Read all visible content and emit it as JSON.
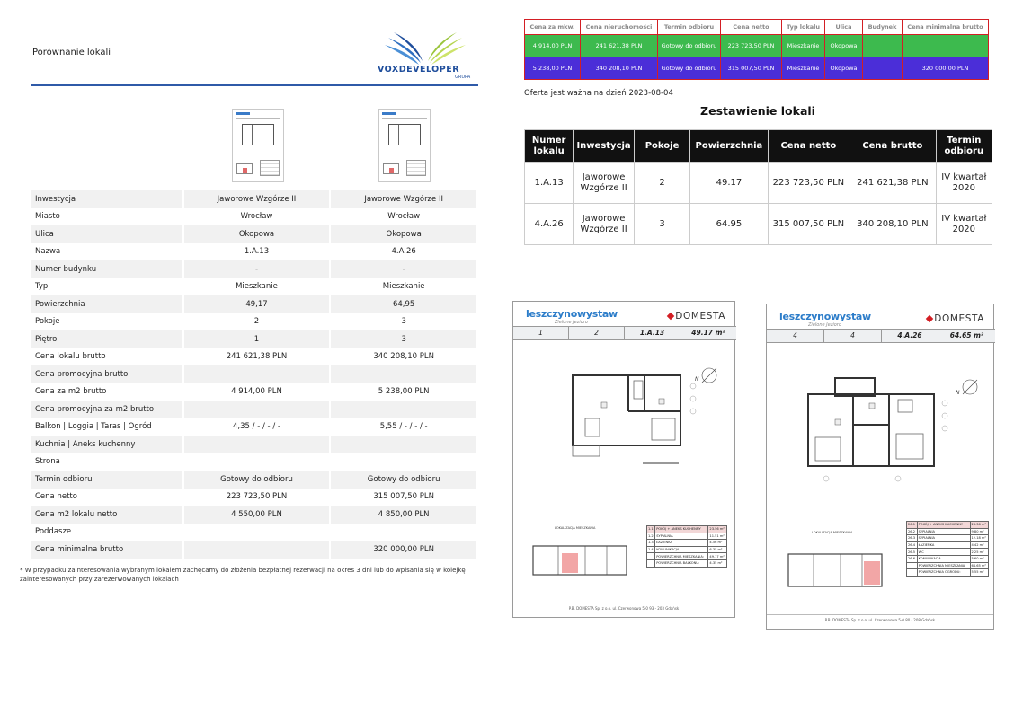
{
  "left": {
    "title": "Porównanie lokali",
    "logo": {
      "wordmark": "VOXDEVELOPER",
      "sub": "GRUPA",
      "colors": [
        "#1f4e9c",
        "#9bc53d"
      ]
    },
    "rows": [
      {
        "label": "Inwestycja",
        "a": "Jaworowe Wzgórze II",
        "b": "Jaworowe Wzgórze II"
      },
      {
        "label": "Miasto",
        "a": "Wrocław",
        "b": "Wrocław"
      },
      {
        "label": "Ulica",
        "a": "Okopowa",
        "b": "Okopowa"
      },
      {
        "label": "Nazwa",
        "a": "1.A.13",
        "b": "4.A.26"
      },
      {
        "label": "Numer budynku",
        "a": "-",
        "b": "-"
      },
      {
        "label": "Typ",
        "a": "Mieszkanie",
        "b": "Mieszkanie"
      },
      {
        "label": "Powierzchnia",
        "a": "49,17",
        "b": "64,95"
      },
      {
        "label": "Pokoje",
        "a": "2",
        "b": "3"
      },
      {
        "label": "Piętro",
        "a": "1",
        "b": "3"
      },
      {
        "label": "Cena lokalu brutto",
        "a": "241 621,38 PLN",
        "b": "340 208,10 PLN"
      },
      {
        "label": "Cena promocyjna brutto",
        "a": "",
        "b": ""
      },
      {
        "label": "Cena za m2 brutto",
        "a": "4 914,00 PLN",
        "b": "5 238,00 PLN"
      },
      {
        "label": "Cena promocyjna za m2 brutto",
        "a": "",
        "b": ""
      },
      {
        "label": "Balkon | Loggia | Taras | Ogród",
        "a": "4,35 / - / - / -",
        "b": "5,55 / - / - / -"
      },
      {
        "label": "Kuchnia | Aneks kuchenny",
        "a": "",
        "b": ""
      },
      {
        "label": "Strona",
        "a": "",
        "b": ""
      },
      {
        "label": "Termin odbioru",
        "a": "Gotowy do odbioru",
        "b": "Gotowy do odbioru"
      },
      {
        "label": "Cena netto",
        "a": "223 723,50 PLN",
        "b": "315 007,50 PLN"
      },
      {
        "label": "Cena m2 lokalu netto",
        "a": "4 550,00 PLN",
        "b": "4 850,00 PLN"
      },
      {
        "label": "Poddasze",
        "a": "",
        "b": ""
      },
      {
        "label": "Cena minimalna brutto",
        "a": "",
        "b": "320 000,00 PLN"
      }
    ],
    "footnote": "* W przypadku zainteresowania wybranym lokalem zachęcamy do złożenia bezpłatnej rezerwacji na okres 3 dni lub do wpisania się w kolejkę zainteresowanych przy zarezerwowanych lokalach"
  },
  "prices": {
    "headers": [
      "Cena za mkw.",
      "Cena nieruchomości",
      "Termin odbioru",
      "Cena netto",
      "Typ lokalu",
      "Ulica",
      "Budynek",
      "Cena minimalna brutto"
    ],
    "rows": [
      {
        "style": "green",
        "cells": [
          "4 914,00 PLN",
          "241 621,38 PLN",
          "Gotowy do odbioru",
          "223 723,50 PLN",
          "Mieszkanie",
          "Okopowa",
          "",
          ""
        ]
      },
      {
        "style": "blue",
        "cells": [
          "5 238,00 PLN",
          "340 208,10 PLN",
          "Gotowy do odbioru",
          "315 007,50 PLN",
          "Mieszkanie",
          "Okopowa",
          "",
          "320 000,00 PLN"
        ]
      }
    ],
    "colors": {
      "green": "#3dba4e",
      "blue": "#4b2ed8",
      "border": "#d31e24"
    }
  },
  "valid_text": "Oferta jest ważna na dzień 2023-08-04",
  "summary": {
    "title": "Zestawienie lokali",
    "headers": [
      "Numer lokalu",
      "Inwestycja",
      "Pokoje",
      "Powierzchnia",
      "Cena netto",
      "Cena brutto",
      "Termin odbioru"
    ],
    "rows": [
      [
        "1.A.13",
        "Jaworowe Wzgórze II",
        "2",
        "49.17",
        "223 723,50 PLN",
        "241 621,38 PLN",
        "IV kwartał 2020"
      ],
      [
        "4.A.26",
        "Jaworowe Wzgórze II",
        "3",
        "64.95",
        "315 007,50 PLN",
        "340 208,10 PLN",
        "IV kwartał 2020"
      ]
    ]
  },
  "cards": [
    {
      "brand": "leszczynowystaw",
      "brand_sub": "Zielone Jezioro",
      "company": "DOMESTA",
      "info": [
        "1",
        "2",
        "1.A.13",
        "49.17 m²"
      ],
      "loc_label": "LOKALIZACJA MIESZKANIA",
      "rooms": [
        [
          "1.1",
          "POKÓJ + ANEKS KUCHENNY",
          "23.56 m²"
        ],
        [
          "1.2",
          "SYPIALNIA",
          "11.51 m²"
        ],
        [
          "1.3",
          "ŁAZIENKA",
          "4.56 m²"
        ],
        [
          "1.4",
          "KOMUNIKACJA",
          "6.35 m²"
        ],
        [
          "",
          "POWIERZCHNIA MIESZKANIA:",
          "49.17 m²"
        ],
        [
          "",
          "POWIERZCHNIA BALKONU:",
          "4.35 m²"
        ]
      ],
      "footer": "P.B. DOMESTA Sp. z o.o.   ul. Czerwonowa 5-0 93 - 203 Gdańsk"
    },
    {
      "brand": "leszczynowystaw",
      "brand_sub": "Zielone Jezioro",
      "company": "DOMESTA",
      "info": [
        "4",
        "4",
        "4.A.26",
        "64.65 m²"
      ],
      "loc_label": "LOKALIZACJA MIESZKANIA",
      "rooms": [
        [
          "26.1",
          "POKÓJ + ANEKS KUCHENNY",
          "23.36 m²"
        ],
        [
          "26.2",
          "SYPIALNIA",
          "9.80 m²"
        ],
        [
          "26.3",
          "SYPIALNIA",
          "12.18 m²"
        ],
        [
          "26.4",
          "ŁAZIENKA",
          "4.42 m²"
        ],
        [
          "26.5",
          "WC",
          "2.25 m²"
        ],
        [
          "26.6",
          "KOMUNIKACJA",
          "5.60 m²"
        ],
        [
          "",
          "POWIERZCHNIA MIESZKANIA:",
          "64.65 m²"
        ],
        [
          "",
          "POWIERZCHNIA OGRODU:",
          "5.55 m²"
        ]
      ],
      "footer": "P.B. DOMESTA Sp. z o.o.   ul. Czerwonowa 5-0 80 - 208 Gdańsk"
    }
  ]
}
